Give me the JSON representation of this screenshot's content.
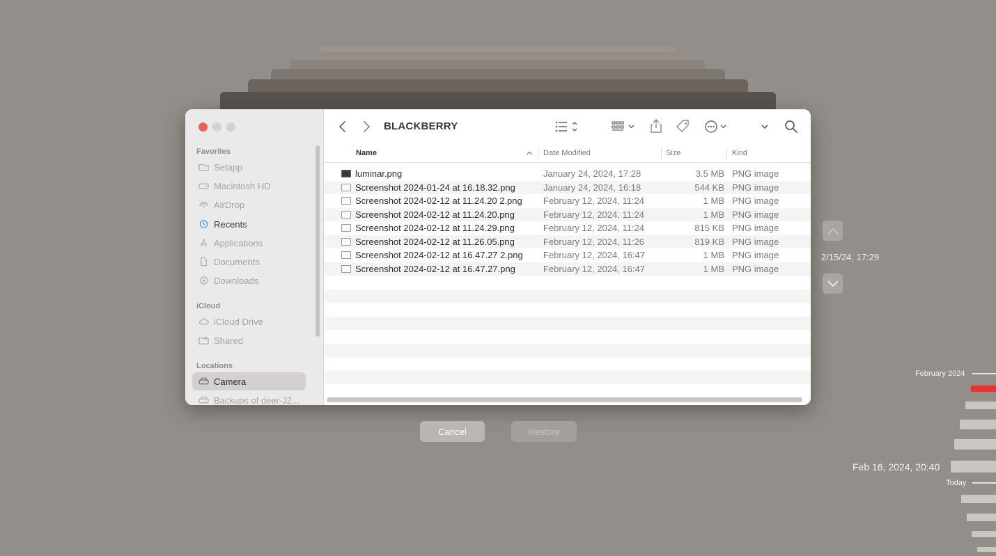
{
  "window": {
    "title": "BLACKBERRY"
  },
  "sidebar": {
    "favorites_header": "Favorites",
    "favorites": [
      {
        "label": "Setapp",
        "icon": "folder-icon"
      },
      {
        "label": "Macintosh HD",
        "icon": "drive-icon"
      },
      {
        "label": "AirDrop",
        "icon": "airdrop-icon"
      },
      {
        "label": "Recents",
        "icon": "clock-icon"
      },
      {
        "label": "Applications",
        "icon": "applications-icon"
      },
      {
        "label": "Documents",
        "icon": "document-icon"
      },
      {
        "label": "Downloads",
        "icon": "download-icon"
      }
    ],
    "icloud_header": "iCloud",
    "icloud": [
      {
        "label": "iCloud Drive",
        "icon": "cloud-icon"
      },
      {
        "label": "Shared",
        "icon": "shared-folder-icon"
      }
    ],
    "locations_header": "Locations",
    "locations": [
      {
        "label": "Camera",
        "icon": "external-drive-icon"
      },
      {
        "label": "Backups of deer-J2...",
        "icon": "external-drive-icon"
      }
    ]
  },
  "columns": {
    "name": "Name",
    "date": "Date Modified",
    "size": "Size",
    "kind": "Kind"
  },
  "files": [
    {
      "name": "luminar.png",
      "date": "January 24, 2024, 17:28",
      "size": "3.5 MB",
      "kind": "PNG image"
    },
    {
      "name": "Screenshot 2024-01-24 at 16.18.32.png",
      "date": "January 24, 2024, 16:18",
      "size": "544 KB",
      "kind": "PNG image"
    },
    {
      "name": "Screenshot 2024-02-12 at 11.24.20 2.png",
      "date": "February 12, 2024, 11:24",
      "size": "1 MB",
      "kind": "PNG image"
    },
    {
      "name": "Screenshot 2024-02-12 at 11.24.20.png",
      "date": "February 12, 2024, 11:24",
      "size": "1 MB",
      "kind": "PNG image"
    },
    {
      "name": "Screenshot 2024-02-12 at 11.24.29.png",
      "date": "February 12, 2024, 11:24",
      "size": "815 KB",
      "kind": "PNG image"
    },
    {
      "name": "Screenshot 2024-02-12 at 11.26.05.png",
      "date": "February 12, 2024, 11:26",
      "size": "819 KB",
      "kind": "PNG image"
    },
    {
      "name": "Screenshot 2024-02-12 at 16.47.27 2.png",
      "date": "February 12, 2024, 16:47",
      "size": "1 MB",
      "kind": "PNG image"
    },
    {
      "name": "Screenshot 2024-02-12 at 16.47.27.png",
      "date": "February 12, 2024, 16:47",
      "size": "1 MB",
      "kind": "PNG image"
    }
  ],
  "buttons": {
    "cancel": "Cancel",
    "restore": "Restore"
  },
  "time_machine": {
    "snapshot_time": "2/15/24, 17:29",
    "current_time": "Feb 16, 2024, 20:40",
    "timeline_month": "February 2024",
    "timeline_today": "Today"
  },
  "colors": {
    "close": "#ec5f57",
    "inactive_light": "#d2d2d2",
    "timeline_active": "#e8342d",
    "background": "#928e89"
  }
}
